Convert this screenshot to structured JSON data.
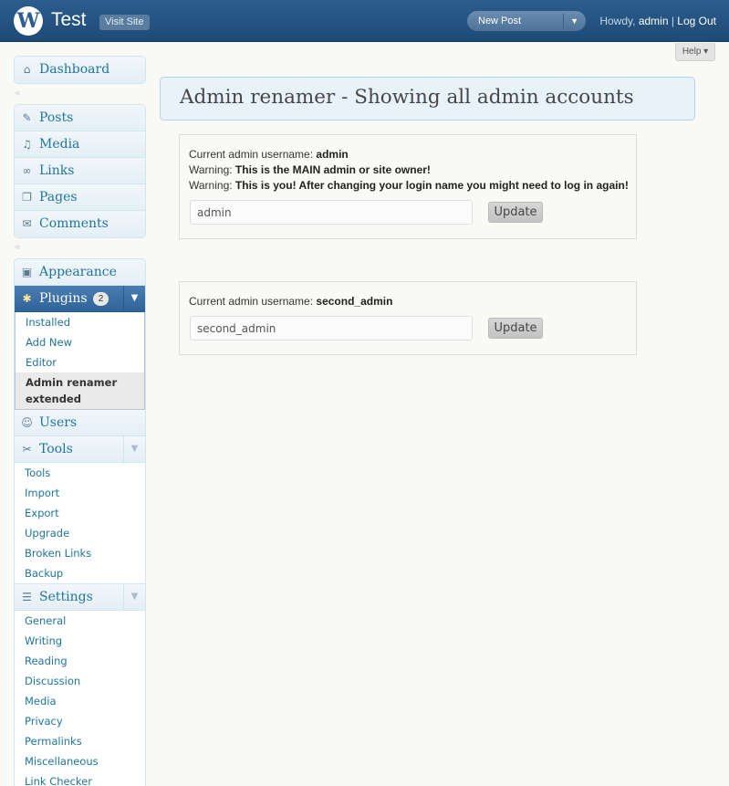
{
  "header": {
    "site_title": "Test",
    "visit_site": "Visit Site",
    "new_post": "New Post",
    "howdy_prefix": "Howdy, ",
    "user": "admin",
    "separator": " | ",
    "logout": "Log Out"
  },
  "help": {
    "label": "Help ▾"
  },
  "sidebar": {
    "dashboard": "Dashboard",
    "posts": "Posts",
    "media": "Media",
    "links": "Links",
    "pages": "Pages",
    "comments": "Comments",
    "appearance": "Appearance",
    "plugins": "Plugins",
    "plugins_count": "2",
    "plugins_submenu": [
      "Installed",
      "Add New",
      "Editor",
      "Admin renamer extended"
    ],
    "users": "Users",
    "tools": "Tools",
    "tools_submenu": [
      "Tools",
      "Import",
      "Export",
      "Upgrade",
      "Broken Links",
      "Backup"
    ],
    "settings": "Settings",
    "settings_submenu": [
      "General",
      "Writing",
      "Reading",
      "Discussion",
      "Media",
      "Privacy",
      "Permalinks",
      "Miscellaneous",
      "Link Checker"
    ]
  },
  "main": {
    "title": "Admin renamer - Showing all admin accounts",
    "accounts": [
      {
        "label": "Current admin username: ",
        "username": "admin",
        "warnings": [
          {
            "prefix": "Warning: ",
            "text": "This is the MAIN admin or site owner!"
          },
          {
            "prefix": "Warning: ",
            "text": "This is you! After changing your login name you might need to log in again!"
          }
        ],
        "input_value": "admin",
        "button": "Update"
      },
      {
        "label": "Current admin username: ",
        "username": "second_admin",
        "input_value": "second_admin",
        "button": "Update"
      }
    ]
  },
  "colors": {
    "header_bg": "#2b5d8e",
    "link": "#21759b",
    "current_menu": "#3a6ea5",
    "title_box_bg": "#e8f2fa"
  }
}
